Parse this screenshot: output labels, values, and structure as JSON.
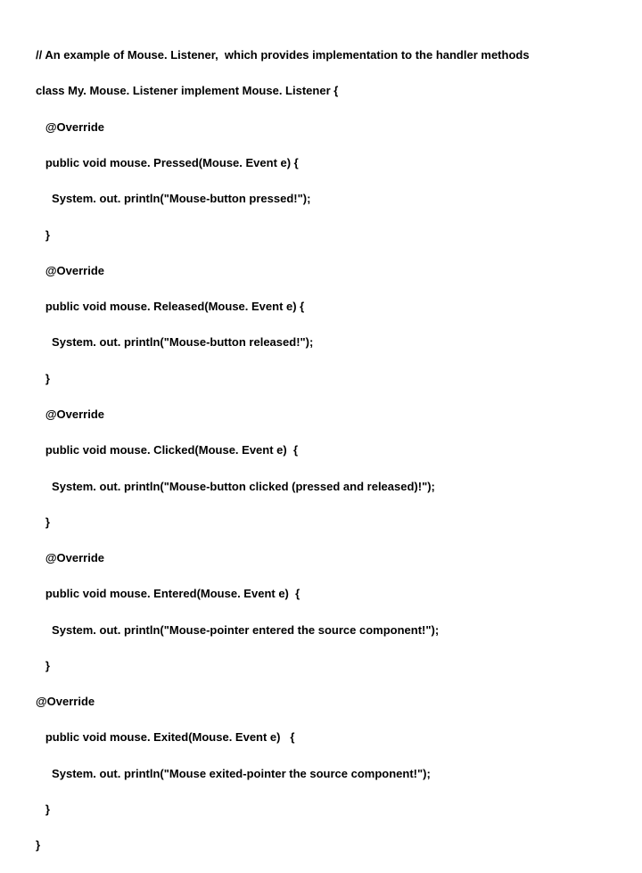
{
  "code": {
    "lines": [
      "// An example of Mouse. Listener,  which provides implementation to the handler methods",
      "class My. Mouse. Listener implement Mouse. Listener {",
      "   @Override",
      "   public void mouse. Pressed(Mouse. Event e) {",
      "     System. out. println(\"Mouse-button pressed!\");",
      "   }",
      "   @Override",
      "   public void mouse. Released(Mouse. Event e) {",
      "     System. out. println(\"Mouse-button released!\");",
      "   }",
      "   @Override",
      "   public void mouse. Clicked(Mouse. Event e)  {",
      "     System. out. println(\"Mouse-button clicked (pressed and released)!\");",
      "   }",
      "   @Override",
      "   public void mouse. Entered(Mouse. Event e)  {",
      "     System. out. println(\"Mouse-pointer entered the source component!\");",
      "   }",
      "@Override",
      "   public void mouse. Exited(Mouse. Event e)   {",
      "     System. out. println(\"Mouse exited-pointer the source component!\");",
      "   }",
      "}"
    ]
  }
}
